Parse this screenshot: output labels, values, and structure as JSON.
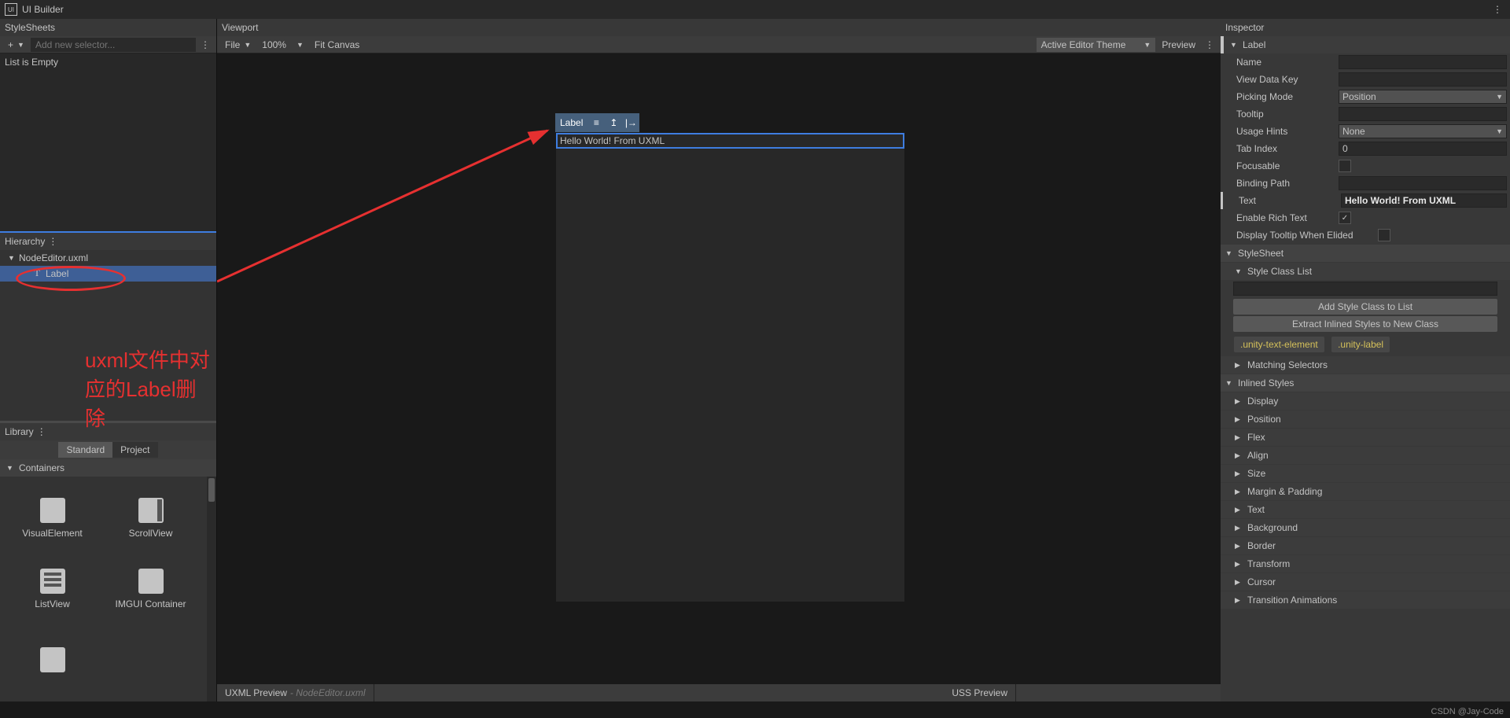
{
  "title": "UI Builder",
  "stylesheets": {
    "header": "StyleSheets",
    "placeholder": "Add new selector...",
    "empty": "List is Empty"
  },
  "hierarchy": {
    "header": "Hierarchy",
    "file": "NodeEditor.uxml",
    "item": "Label"
  },
  "annotation": "uxml文件中对应的Label删除",
  "library": {
    "header": "Library",
    "tabs": {
      "standard": "Standard",
      "project": "Project"
    },
    "category": "Containers",
    "items": [
      "VisualElement",
      "ScrollView",
      "ListView",
      "IMGUI Container"
    ]
  },
  "viewport": {
    "header": "Viewport",
    "file": "File",
    "zoom": "100%",
    "fit": "Fit Canvas",
    "theme": "Active Editor Theme",
    "preview": "Preview",
    "label_chip": "Label",
    "label_text": "Hello World! From UXML"
  },
  "previews": {
    "uxml": "UXML Preview",
    "uxml_file": "- NodeEditor.uxml",
    "uss": "USS Preview"
  },
  "inspector": {
    "header": "Inspector",
    "selected": "Label",
    "fields": {
      "name": "Name",
      "viewDataKey": "View Data Key",
      "pickingMode": "Picking Mode",
      "pickingModeVal": "Position",
      "tooltip": "Tooltip",
      "usageHints": "Usage Hints",
      "usageHintsVal": "None",
      "tabIndex": "Tab Index",
      "tabIndexVal": "0",
      "focusable": "Focusable",
      "bindingPath": "Binding Path",
      "text": "Text",
      "textVal": "Hello World! From UXML",
      "enableRichText": "Enable Rich Text",
      "displayTooltip": "Display Tooltip When Elided"
    },
    "stylesheet": "StyleSheet",
    "styleClassList": "Style Class List",
    "addStyleClass": "Add Style Class to List",
    "extractStyles": "Extract Inlined Styles to New Class",
    "badges": [
      ".unity-text-element",
      ".unity-label"
    ],
    "matchingSelectors": "Matching Selectors",
    "inlinedStyles": "Inlined Styles",
    "foldouts": [
      "Display",
      "Position",
      "Flex",
      "Align",
      "Size",
      "Margin & Padding",
      "Text",
      "Background",
      "Border",
      "Transform",
      "Cursor",
      "Transition Animations"
    ]
  },
  "watermark": "CSDN @Jay-Code"
}
